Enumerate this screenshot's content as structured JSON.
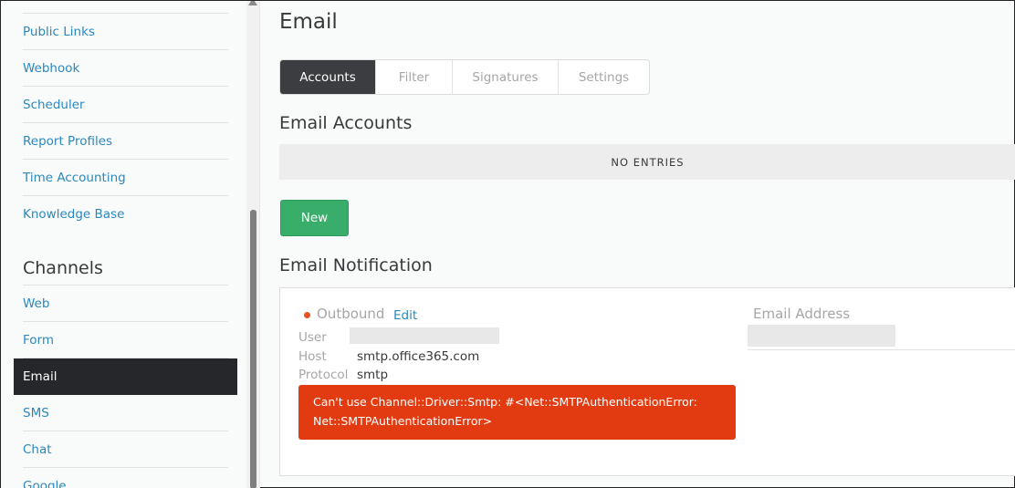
{
  "sidebar": {
    "items_top": [
      {
        "label": "Public Links"
      },
      {
        "label": "Webhook"
      },
      {
        "label": "Scheduler"
      },
      {
        "label": "Report Profiles"
      },
      {
        "label": "Time Accounting"
      },
      {
        "label": "Knowledge Base"
      }
    ],
    "section_title": "Channels",
    "items_channels": [
      {
        "label": "Web"
      },
      {
        "label": "Form"
      },
      {
        "label": "Email"
      },
      {
        "label": "SMS"
      },
      {
        "label": "Chat"
      },
      {
        "label": "Google"
      }
    ],
    "active_item": "Email"
  },
  "main": {
    "title": "Email",
    "tabs": [
      {
        "label": "Accounts"
      },
      {
        "label": "Filter"
      },
      {
        "label": "Signatures"
      },
      {
        "label": "Settings"
      }
    ],
    "active_tab": "Accounts",
    "email_accounts_heading": "Email Accounts",
    "empty_text": "NO ENTRIES",
    "new_button_label": "New",
    "email_notification_heading": "Email Notification",
    "notification": {
      "status": "Outbound",
      "edit_label": "Edit",
      "user_label": "User",
      "host_label": "Host",
      "host_value": "smtp.office365.com",
      "protocol_label": "Protocol",
      "protocol_value": "smtp",
      "error_line1": "Can't use Channel::Driver::Smtp: #<Net::SMTPAuthenticationError:",
      "error_line2": "Net::SMTPAuthenticationError>",
      "email_address_label": "Email Address"
    }
  },
  "colors": {
    "link": "#2a88bd",
    "active_bg": "#26272a",
    "success": "#38ae6a",
    "error": "#e23b12",
    "status_dot": "#e6541f"
  }
}
